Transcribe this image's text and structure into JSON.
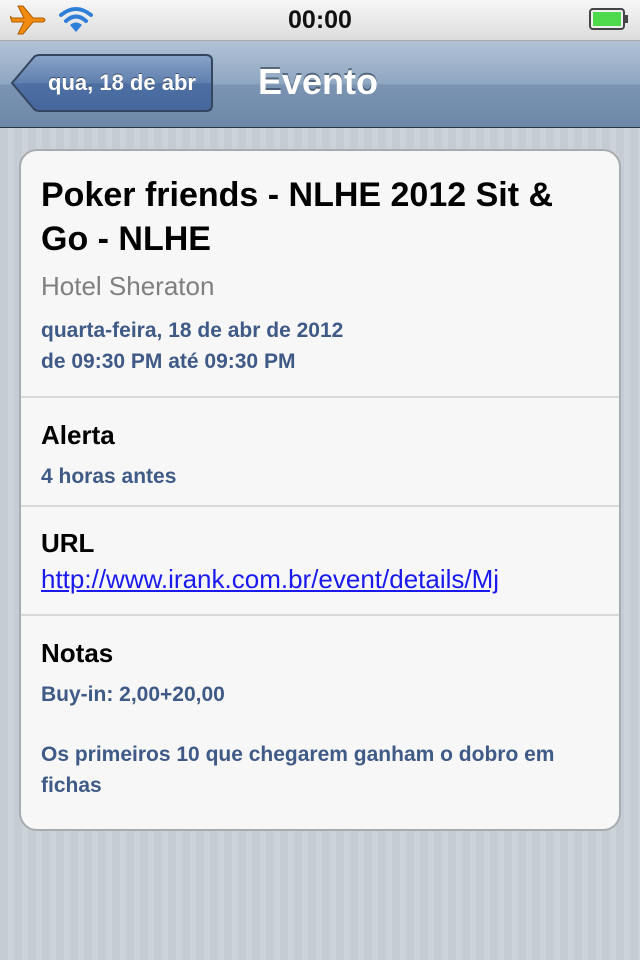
{
  "status_bar": {
    "time": "00:00",
    "icons": [
      "airplane-icon",
      "wifi-icon",
      "battery-icon"
    ],
    "battery_color": "#4cd94c"
  },
  "nav": {
    "back_label": "qua, 18 de abr",
    "title": "Evento"
  },
  "event": {
    "title": "Poker friends - NLHE 2012 Sit & Go - NLHE",
    "location": "Hotel Sheraton",
    "date": "quarta-feira, 18 de abr de 2012",
    "time": "de 09:30 PM até 09:30 PM"
  },
  "alert": {
    "heading": "Alerta",
    "value": "4 horas antes"
  },
  "url": {
    "heading": "URL",
    "value": "http://www.irank.com.br/event/details/Mj"
  },
  "notes": {
    "heading": "Notas",
    "line1": "Buy-in: 2,00+20,00",
    "line2": "Os primeiros 10 que chegarem ganham o dobro em fichas"
  },
  "colors": {
    "nav_bar": "#7b94b3",
    "detail_blue": "#3f5a86",
    "link": "#1a1aee"
  }
}
